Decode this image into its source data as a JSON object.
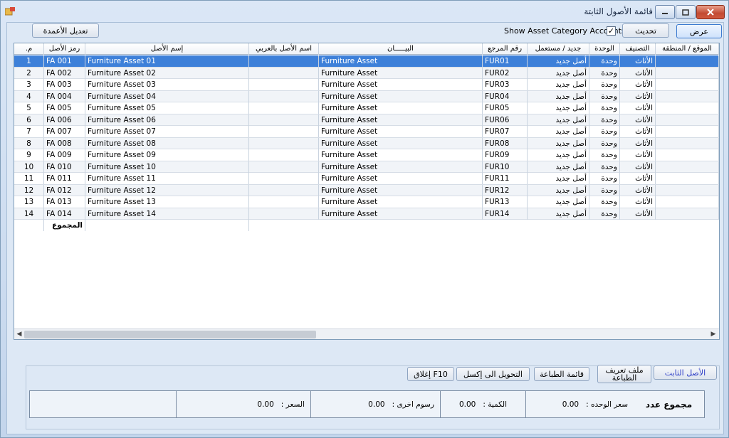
{
  "window": {
    "title": "قائمة الأصول الثابتة"
  },
  "toolbar": {
    "edit_columns": "تعديل الأعمدة",
    "show_category_label": "Show Asset Category Accounts",
    "show_category_checked": "✓",
    "refresh": "تحديث",
    "view": "عرض"
  },
  "grid": {
    "headers": {
      "no": "م.",
      "code": "رمز الأصل",
      "name": "إسم الأصل",
      "name_ar": "اسم الأصل بالعربي",
      "desc": "البيـــــان",
      "ref": "رقم المرجع",
      "status": "جديد / مستعمل",
      "unit": "الوحدة",
      "category": "التصنيف",
      "location": "الموقع / المنطقة"
    },
    "rows": [
      {
        "no": "1",
        "code": "FA 001",
        "name": "Furniture Asset 01",
        "name_ar": "",
        "desc": "Furniture Asset",
        "ref": "FUR01",
        "status": "أصل جديد",
        "unit": "وحدة",
        "category": "الأثاث",
        "location": ""
      },
      {
        "no": "2",
        "code": "FA 002",
        "name": "Furniture Asset 02",
        "name_ar": "",
        "desc": "Furniture Asset",
        "ref": "FUR02",
        "status": "أصل جديد",
        "unit": "وحدة",
        "category": "الأثاث",
        "location": ""
      },
      {
        "no": "3",
        "code": "FA 003",
        "name": "Furniture Asset 03",
        "name_ar": "",
        "desc": "Furniture Asset",
        "ref": "FUR03",
        "status": "أصل جديد",
        "unit": "وحدة",
        "category": "الأثاث",
        "location": ""
      },
      {
        "no": "4",
        "code": "FA 004",
        "name": "Furniture Asset 04",
        "name_ar": "",
        "desc": "Furniture Asset",
        "ref": "FUR04",
        "status": "أصل جديد",
        "unit": "وحدة",
        "category": "الأثاث",
        "location": ""
      },
      {
        "no": "5",
        "code": "FA 005",
        "name": "Furniture Asset 05",
        "name_ar": "",
        "desc": "Furniture Asset",
        "ref": "FUR05",
        "status": "أصل جديد",
        "unit": "وحدة",
        "category": "الأثاث",
        "location": ""
      },
      {
        "no": "6",
        "code": "FA 006",
        "name": "Furniture Asset 06",
        "name_ar": "",
        "desc": "Furniture Asset",
        "ref": "FUR06",
        "status": "أصل جديد",
        "unit": "وحدة",
        "category": "الأثاث",
        "location": ""
      },
      {
        "no": "7",
        "code": "FA 007",
        "name": "Furniture Asset 07",
        "name_ar": "",
        "desc": "Furniture Asset",
        "ref": "FUR07",
        "status": "أصل جديد",
        "unit": "وحدة",
        "category": "الأثاث",
        "location": ""
      },
      {
        "no": "8",
        "code": "FA 008",
        "name": "Furniture Asset 08",
        "name_ar": "",
        "desc": "Furniture Asset",
        "ref": "FUR08",
        "status": "أصل جديد",
        "unit": "وحدة",
        "category": "الأثاث",
        "location": ""
      },
      {
        "no": "9",
        "code": "FA 009",
        "name": "Furniture Asset 09",
        "name_ar": "",
        "desc": "Furniture Asset",
        "ref": "FUR09",
        "status": "أصل جديد",
        "unit": "وحدة",
        "category": "الأثاث",
        "location": ""
      },
      {
        "no": "10",
        "code": "FA 010",
        "name": "Furniture Asset 10",
        "name_ar": "",
        "desc": "Furniture Asset",
        "ref": "FUR10",
        "status": "أصل جديد",
        "unit": "وحدة",
        "category": "الأثاث",
        "location": ""
      },
      {
        "no": "11",
        "code": "FA 011",
        "name": "Furniture Asset 11",
        "name_ar": "",
        "desc": "Furniture Asset",
        "ref": "FUR11",
        "status": "أصل جديد",
        "unit": "وحدة",
        "category": "الأثاث",
        "location": ""
      },
      {
        "no": "12",
        "code": "FA 012",
        "name": "Furniture Asset 12",
        "name_ar": "",
        "desc": "Furniture Asset",
        "ref": "FUR12",
        "status": "أصل جديد",
        "unit": "وحدة",
        "category": "الأثاث",
        "location": ""
      },
      {
        "no": "13",
        "code": "FA 013",
        "name": "Furniture Asset 13",
        "name_ar": "",
        "desc": "Furniture Asset",
        "ref": "FUR13",
        "status": "أصل جديد",
        "unit": "وحدة",
        "category": "الأثاث",
        "location": ""
      },
      {
        "no": "14",
        "code": "FA 014",
        "name": "Furniture Asset 14",
        "name_ar": "",
        "desc": "Furniture Asset",
        "ref": "FUR14",
        "status": "أصل جديد",
        "unit": "وحدة",
        "category": "الأثاث",
        "location": ""
      }
    ],
    "total_label": "المجموع"
  },
  "actions": {
    "fixed_asset": "الأصل الثابت",
    "print_profile": "ملف تعريف الطباعة",
    "print_list": "قائمة الطباعة",
    "export_excel": "التحويل الى إكسل",
    "close": "إغلاق F10"
  },
  "summary": {
    "title": "مجموع عدد",
    "unit_price_label": "سعر الوحده :",
    "unit_price": "0.00",
    "qty_label": "الكمية :",
    "qty": "0.00",
    "other_fees_label": "رسوم اخرى :",
    "other_fees": "0.00",
    "price_label": "السعر :",
    "price": "0.00"
  }
}
